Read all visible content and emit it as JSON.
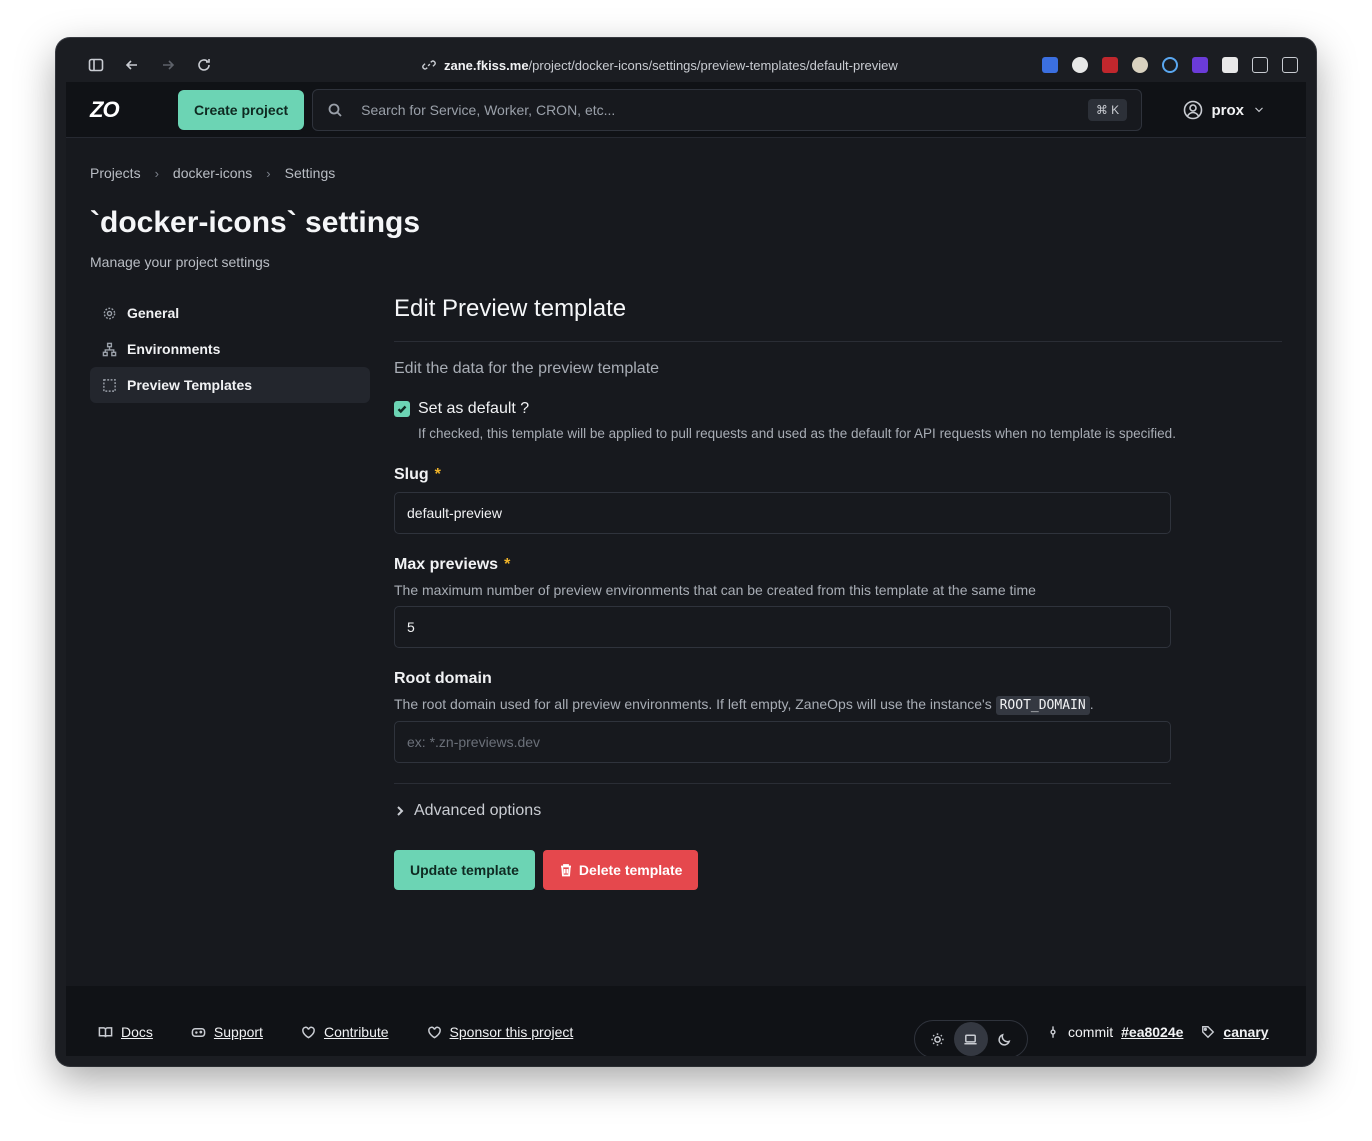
{
  "browser": {
    "url_host": "zane.fkiss.me",
    "url_path": "/project/docker-icons/settings/preview-templates/default-preview"
  },
  "header": {
    "logo": "ZO",
    "create_label": "Create project",
    "search_placeholder": "Search for Service, Worker, CRON, etc...",
    "search_shortcut": "⌘ K",
    "user_name": "prox"
  },
  "breadcrumb": [
    "Projects",
    "docker-icons",
    "Settings"
  ],
  "page": {
    "title": "`docker-icons` settings",
    "subtitle": "Manage your project settings"
  },
  "sidebar": {
    "items": [
      {
        "label": "General",
        "icon": "gear-icon"
      },
      {
        "label": "Environments",
        "icon": "network-icon"
      },
      {
        "label": "Preview Templates",
        "icon": "template-icon",
        "active": true
      }
    ]
  },
  "form": {
    "title": "Edit Preview template",
    "description": "Edit the data for the preview template",
    "default_label": "Set as default ?",
    "default_checked": true,
    "default_help": "If checked, this template will be applied to pull requests and used as the default for API requests when no template is specified.",
    "slug_label": "Slug",
    "slug_value": "default-preview",
    "max_label": "Max previews",
    "max_help": "The maximum number of preview environments that can be created from this template at the same time",
    "max_value": "5",
    "root_label": "Root domain",
    "root_help_prefix": "The root domain used for all preview environments. If left empty, ZaneOps will use the instance's",
    "root_help_code": "ROOT_DOMAIN",
    "root_help_suffix": ".",
    "root_placeholder": "ex: *.zn-previews.dev",
    "advanced_label": "Advanced options",
    "update_label": "Update template",
    "delete_label": "Delete template",
    "required_mark": "*"
  },
  "footer": {
    "docs": "Docs",
    "support": "Support",
    "contribute": "Contribute",
    "sponsor": "Sponsor this project",
    "commit_label": "commit",
    "commit_hash": "#ea8024e",
    "channel": "canary"
  },
  "colors": {
    "accent": "#6cd4b4",
    "danger": "#e5484d",
    "required": "#f0b429"
  }
}
